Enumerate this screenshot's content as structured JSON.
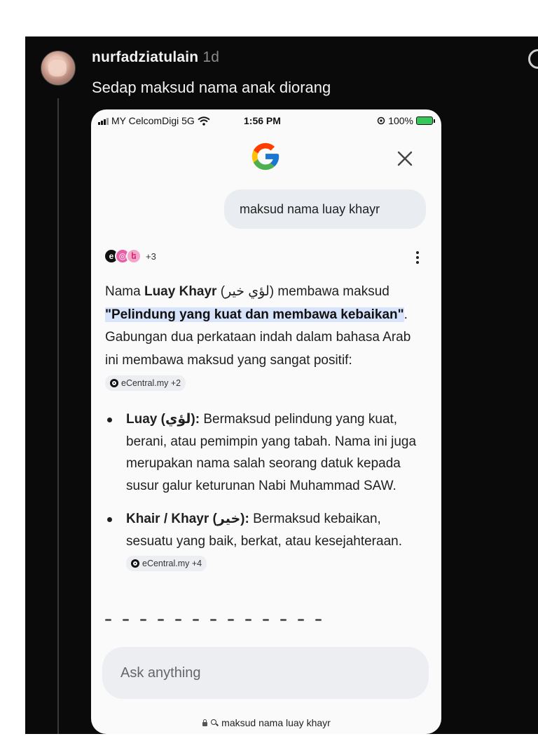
{
  "post": {
    "username": "nurfadziatulain",
    "timestamp": "1d",
    "caption": "Sedap maksud nama anak diorang"
  },
  "phone": {
    "status_bar": {
      "carrier": "MY CelcomDigi 5G",
      "time": "1:56 PM",
      "battery": "100%"
    },
    "query": "maksud nama luay khayr",
    "sources_more": "+3",
    "answer": {
      "p1_a": "Nama ",
      "p1_name": "Luay Khayr",
      "p1_b": " (لؤي خير) membawa maksud ",
      "p1_highlight": "\"Pelindung yang kuat dan membawa kebaikan\"",
      "p1_c": ". Gabungan dua perkataan indah dalam bahasa Arab ini membawa maksud yang sangat positif: ",
      "chip1": "eCentral.my +2"
    },
    "bullets": [
      {
        "term": "Luay (لؤي):",
        "text": " Bermaksud pelindung yang kuat, berani, atau pemimpin yang tabah. Nama ini juga merupakan nama salah seorang datuk kepada susur galur keturunan Nabi Muhammad SAW."
      },
      {
        "term": "Khair / Khayr (خير):",
        "text": " Bermaksud kebaikan, sesuatu yang baik, berkat, atau kesejahteraan. ",
        "chip": "eCentral.my +4"
      }
    ],
    "ask_placeholder": "Ask anything",
    "url": "maksud nama luay khayr"
  }
}
